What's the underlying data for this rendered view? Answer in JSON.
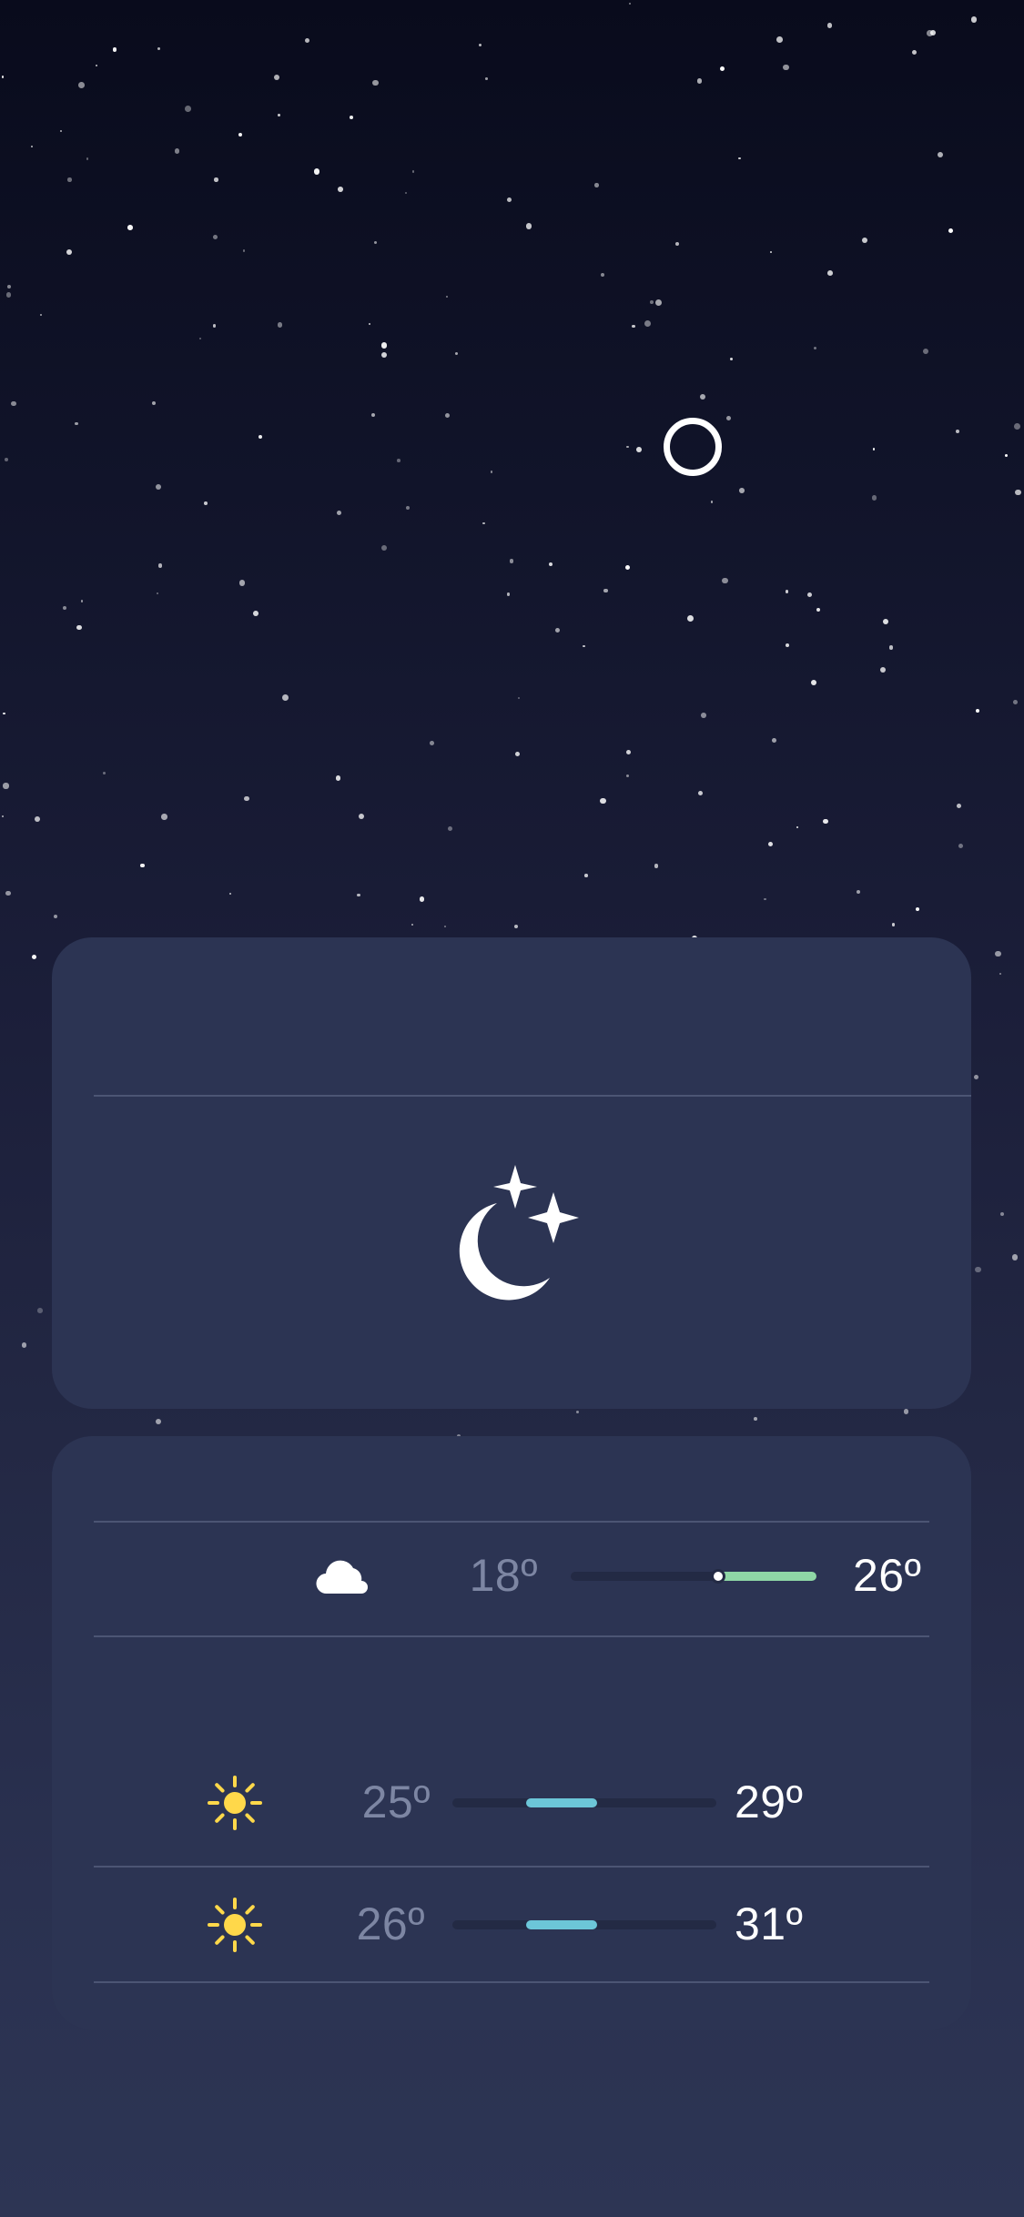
{
  "theme": {
    "card_background": "#2c3453",
    "divider": "#4c5574",
    "low_temp_text": "#7d86a3",
    "high_temp_text": "#ffffff",
    "sun_color": "#ffd84a"
  },
  "header": {
    "location_indicator_icon": "circle-outline-icon"
  },
  "hourly_card": {
    "condition_icon": "moon-stars-icon"
  },
  "daily_forecast": [
    {
      "icon": "cloud-icon",
      "low": "18º",
      "high": "26º",
      "bar_color": "#8fd7a6",
      "range_start": 0.58,
      "range_end": 1.0,
      "current_marker": 0.6
    },
    {
      "icon": "sun-icon",
      "low": "25º",
      "high": "29º",
      "bar_color": "#6cc6d8",
      "range_start": 0.28,
      "range_end": 0.55
    },
    {
      "icon": "sun-icon",
      "low": "26º",
      "high": "31º",
      "bar_color": "#6cc6d8",
      "range_start": 0.28,
      "range_end": 0.55
    }
  ]
}
